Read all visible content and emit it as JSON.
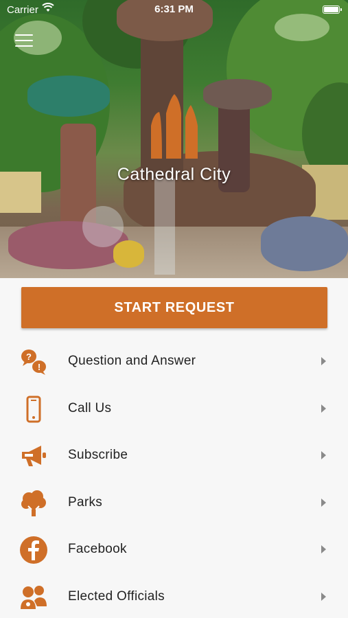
{
  "status_bar": {
    "carrier": "Carrier",
    "time": "6:31 PM"
  },
  "brand": {
    "name": "Cathedral City",
    "accent_color": "#cf6f28"
  },
  "start_request": {
    "label": "START REQUEST"
  },
  "menu_items": [
    {
      "label": "Question and Answer",
      "icon": "question-answer-icon"
    },
    {
      "label": "Call Us",
      "icon": "phone-icon"
    },
    {
      "label": "Subscribe",
      "icon": "megaphone-icon"
    },
    {
      "label": "Parks",
      "icon": "tree-icon"
    },
    {
      "label": "Facebook",
      "icon": "facebook-icon"
    },
    {
      "label": "Elected Officials",
      "icon": "people-icon"
    }
  ]
}
